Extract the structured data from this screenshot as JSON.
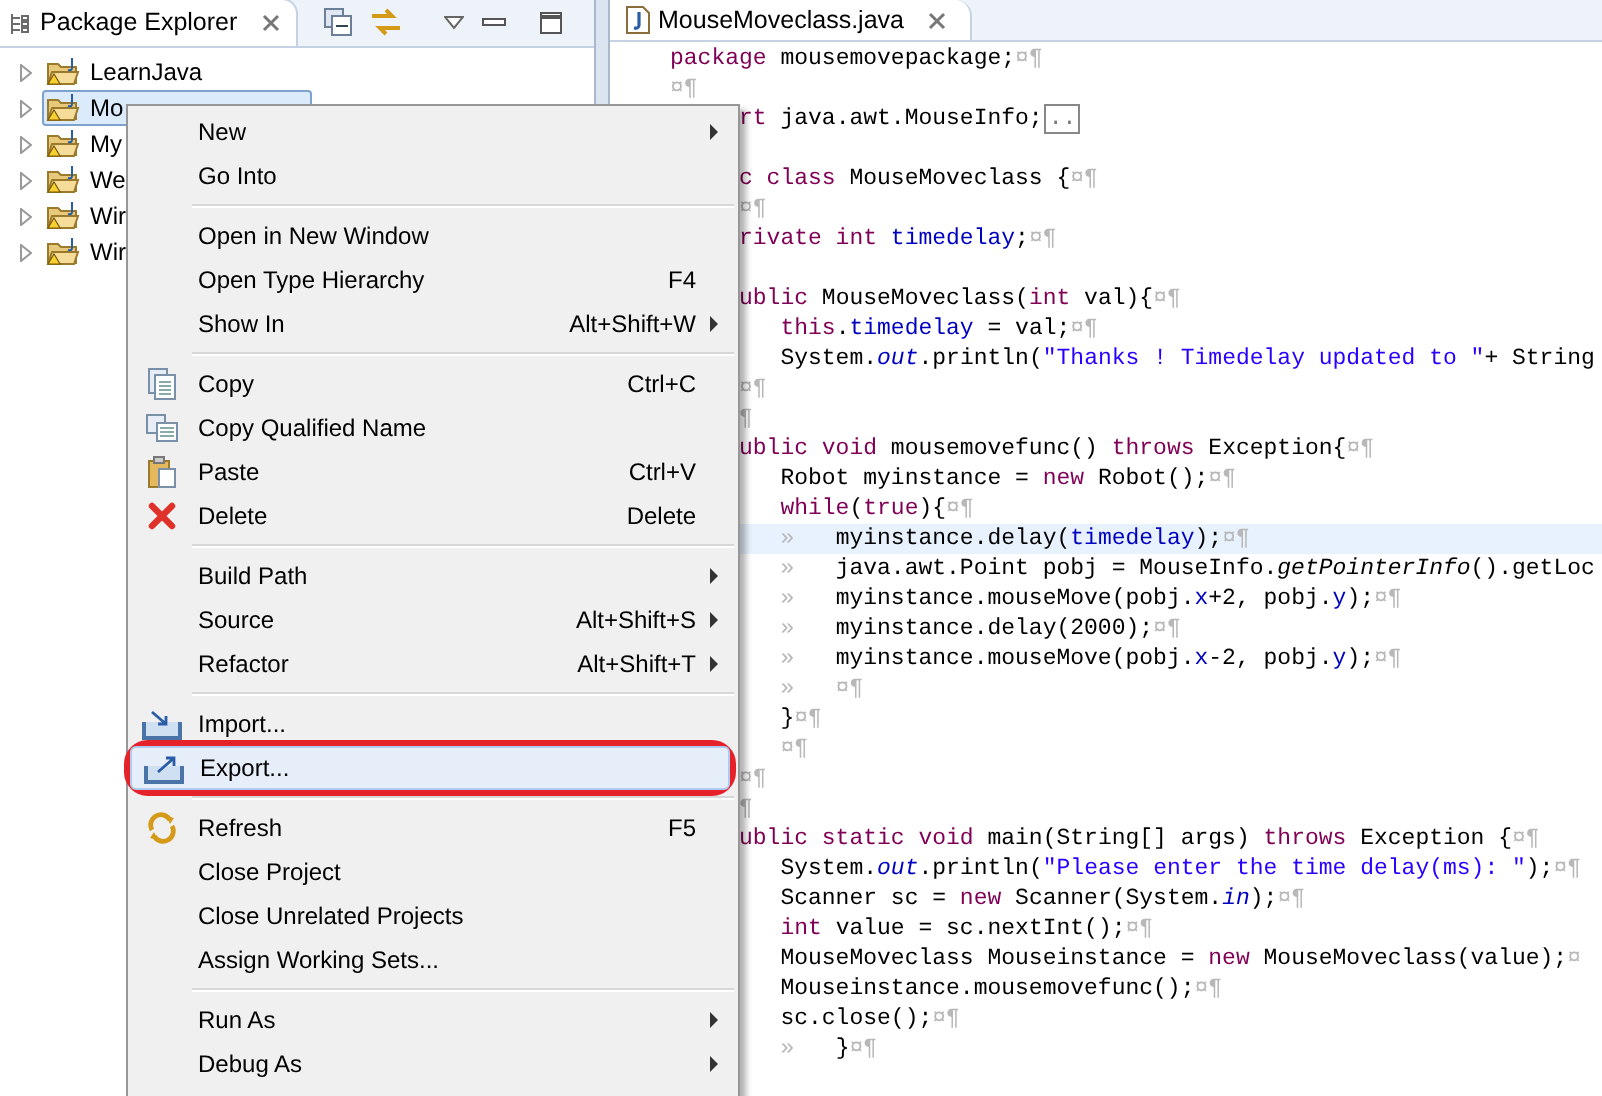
{
  "package_explorer": {
    "title": "Package Explorer",
    "tree": [
      {
        "label": "LearnJava",
        "selected": false,
        "expanded": false
      },
      {
        "label": "Mo",
        "selected": true,
        "expanded": false
      },
      {
        "label": "My",
        "selected": false,
        "expanded": false
      },
      {
        "label": "We",
        "selected": false,
        "expanded": false
      },
      {
        "label": "Wir",
        "selected": false,
        "expanded": false
      },
      {
        "label": "Wir",
        "selected": false,
        "expanded": false
      }
    ]
  },
  "editor": {
    "tab": "MouseMoveclass.java",
    "lines": [
      {
        "kind": "top",
        "current": false,
        "tokens": [
          {
            "kind": "kw",
            "text": "package"
          },
          {
            "kind": "p",
            "text": " mousemovepackage;"
          },
          {
            "kind": "ws",
            "text": "¤¶"
          }
        ]
      },
      {
        "kind": "top",
        "current": false,
        "tokens": [
          {
            "kind": "ws",
            "text": "¤¶"
          }
        ]
      },
      {
        "kind": "cut",
        "current": false,
        "tokens": [
          {
            "kind": "kw",
            "text": "rt"
          },
          {
            "kind": "p",
            "text": " java.awt.MouseInfo;"
          },
          {
            "kind": "fold",
            "text": ".."
          }
        ]
      },
      {
        "kind": "blank",
        "current": false
      },
      {
        "kind": "cut",
        "current": false,
        "tokens": [
          {
            "kind": "kw",
            "text": "c class"
          },
          {
            "kind": "p",
            "text": " MouseMoveclass {"
          },
          {
            "kind": "ws",
            "text": "¤¶"
          }
        ]
      },
      {
        "kind": "cut",
        "current": false,
        "tokens": [
          {
            "kind": "ws",
            "text": "¤¶"
          }
        ]
      },
      {
        "kind": "cut",
        "current": false,
        "tokens": [
          {
            "kind": "kw",
            "text": "rivate int"
          },
          {
            "kind": "fld",
            "text": " timedelay"
          },
          {
            "kind": "p",
            "text": ";"
          },
          {
            "kind": "ws",
            "text": "¤¶"
          }
        ]
      },
      {
        "kind": "blank",
        "current": false
      },
      {
        "kind": "cut",
        "current": false,
        "tokens": [
          {
            "kind": "kw",
            "text": "ublic"
          },
          {
            "kind": "p",
            "text": " MouseMoveclass("
          },
          {
            "kind": "kw",
            "text": "int"
          },
          {
            "kind": "p",
            "text": " val){"
          },
          {
            "kind": "ws",
            "text": "¤¶"
          }
        ]
      },
      {
        "kind": "body",
        "current": false,
        "tokens": [
          {
            "kind": "kw",
            "text": "this"
          },
          {
            "kind": "p",
            "text": "."
          },
          {
            "kind": "fld",
            "text": "timedelay"
          },
          {
            "kind": "p",
            "text": " = val;"
          },
          {
            "kind": "ws",
            "text": "¤¶"
          }
        ]
      },
      {
        "kind": "body",
        "current": false,
        "tokens": [
          {
            "kind": "p",
            "text": "System."
          },
          {
            "kind": "sfld",
            "text": "out"
          },
          {
            "kind": "p",
            "text": ".println("
          },
          {
            "kind": "str",
            "text": "\"Thanks ! Timedelay updated to \""
          },
          {
            "kind": "p",
            "text": "+ String"
          }
        ]
      },
      {
        "kind": "cut",
        "current": false,
        "tokens": [
          {
            "kind": "ws",
            "text": "¤¶"
          }
        ]
      },
      {
        "kind": "cut",
        "current": false,
        "tokens": [
          {
            "kind": "ws",
            "text": "¶"
          }
        ]
      },
      {
        "kind": "cut",
        "current": false,
        "tokens": [
          {
            "kind": "kw",
            "text": "ublic void"
          },
          {
            "kind": "p",
            "text": " mousemovefunc() "
          },
          {
            "kind": "kw",
            "text": "throws"
          },
          {
            "kind": "p",
            "text": " Exception{"
          },
          {
            "kind": "ws",
            "text": "¤¶"
          }
        ]
      },
      {
        "kind": "body",
        "current": false,
        "tokens": [
          {
            "kind": "p",
            "text": "Robot myinstance = "
          },
          {
            "kind": "kw",
            "text": "new"
          },
          {
            "kind": "p",
            "text": " Robot();"
          },
          {
            "kind": "ws",
            "text": "¤¶"
          }
        ]
      },
      {
        "kind": "body",
        "current": false,
        "tokens": [
          {
            "kind": "kw",
            "text": "while"
          },
          {
            "kind": "p",
            "text": "("
          },
          {
            "kind": "kw",
            "text": "true"
          },
          {
            "kind": "p",
            "text": "){"
          },
          {
            "kind": "ws",
            "text": "¤¶"
          }
        ]
      },
      {
        "kind": "body",
        "current": true,
        "tokens": [
          {
            "kind": "ws",
            "text": "»"
          },
          {
            "kind": "p",
            "text": "   myinstance.delay("
          },
          {
            "kind": "fld",
            "text": "timedelay"
          },
          {
            "kind": "p",
            "text": ");"
          },
          {
            "kind": "ws",
            "text": "¤¶"
          }
        ]
      },
      {
        "kind": "body",
        "current": false,
        "tokens": [
          {
            "kind": "ws",
            "text": "»"
          },
          {
            "kind": "p",
            "text": "   java.awt.Point pobj = MouseInfo."
          },
          {
            "kind": "it",
            "text": "getPointerInfo"
          },
          {
            "kind": "p",
            "text": "().getLoc"
          }
        ]
      },
      {
        "kind": "body",
        "current": false,
        "tokens": [
          {
            "kind": "ws",
            "text": "»"
          },
          {
            "kind": "p",
            "text": "   myinstance.mouseMove(pobj."
          },
          {
            "kind": "fld",
            "text": "x"
          },
          {
            "kind": "p",
            "text": "+2, pobj."
          },
          {
            "kind": "fld",
            "text": "y"
          },
          {
            "kind": "p",
            "text": ");"
          },
          {
            "kind": "ws",
            "text": "¤¶"
          }
        ]
      },
      {
        "kind": "body",
        "current": false,
        "tokens": [
          {
            "kind": "ws",
            "text": "»"
          },
          {
            "kind": "p",
            "text": "   myinstance.delay(2000);"
          },
          {
            "kind": "ws",
            "text": "¤¶"
          }
        ]
      },
      {
        "kind": "body",
        "current": false,
        "tokens": [
          {
            "kind": "ws",
            "text": "»"
          },
          {
            "kind": "p",
            "text": "   myinstance.mouseMove(pobj."
          },
          {
            "kind": "fld",
            "text": "x"
          },
          {
            "kind": "p",
            "text": "-2, pobj."
          },
          {
            "kind": "fld",
            "text": "y"
          },
          {
            "kind": "p",
            "text": ");"
          },
          {
            "kind": "ws",
            "text": "¤¶"
          }
        ]
      },
      {
        "kind": "body",
        "current": false,
        "tokens": [
          {
            "kind": "ws",
            "text": "»   ¤¶"
          }
        ]
      },
      {
        "kind": "body",
        "current": false,
        "tokens": [
          {
            "kind": "p",
            "text": "}"
          },
          {
            "kind": "ws",
            "text": "¤¶"
          }
        ]
      },
      {
        "kind": "body",
        "current": false,
        "tokens": [
          {
            "kind": "ws",
            "text": "¤¶"
          }
        ]
      },
      {
        "kind": "cut",
        "current": false,
        "tokens": [
          {
            "kind": "ws",
            "text": "¤¶"
          }
        ]
      },
      {
        "kind": "cut",
        "current": false,
        "tokens": [
          {
            "kind": "ws",
            "text": "¶"
          }
        ]
      },
      {
        "kind": "cut",
        "current": false,
        "tokens": [
          {
            "kind": "kw",
            "text": "ublic static void"
          },
          {
            "kind": "p",
            "text": " main(String[] args) "
          },
          {
            "kind": "kw",
            "text": "throws"
          },
          {
            "kind": "p",
            "text": " Exception {"
          },
          {
            "kind": "ws",
            "text": "¤¶"
          }
        ]
      },
      {
        "kind": "body",
        "current": false,
        "tokens": [
          {
            "kind": "p",
            "text": "System."
          },
          {
            "kind": "sfld",
            "text": "out"
          },
          {
            "kind": "p",
            "text": ".println("
          },
          {
            "kind": "str",
            "text": "\"Please enter the time delay(ms): \""
          },
          {
            "kind": "p",
            "text": ");"
          },
          {
            "kind": "ws",
            "text": "¤¶"
          }
        ]
      },
      {
        "kind": "body",
        "current": false,
        "tokens": [
          {
            "kind": "p",
            "text": "Scanner sc = "
          },
          {
            "kind": "kw",
            "text": "new"
          },
          {
            "kind": "p",
            "text": " Scanner(System."
          },
          {
            "kind": "sfld",
            "text": "in"
          },
          {
            "kind": "p",
            "text": ");"
          },
          {
            "kind": "ws",
            "text": "¤¶"
          }
        ]
      },
      {
        "kind": "body",
        "current": false,
        "tokens": [
          {
            "kind": "kw",
            "text": "int"
          },
          {
            "kind": "p",
            "text": " value = sc.nextInt();"
          },
          {
            "kind": "ws",
            "text": "¤¶"
          }
        ]
      },
      {
        "kind": "body",
        "current": false,
        "tokens": [
          {
            "kind": "p",
            "text": "MouseMoveclass Mouseinstance = "
          },
          {
            "kind": "kw",
            "text": "new"
          },
          {
            "kind": "p",
            "text": " MouseMoveclass(value);"
          },
          {
            "kind": "ws",
            "text": "¤"
          }
        ]
      },
      {
        "kind": "body",
        "current": false,
        "tokens": [
          {
            "kind": "p",
            "text": "Mouseinstance.mousemovefunc();"
          },
          {
            "kind": "ws",
            "text": "¤¶"
          }
        ]
      },
      {
        "kind": "body",
        "current": false,
        "tokens": [
          {
            "kind": "p",
            "text": "sc.close();"
          },
          {
            "kind": "ws",
            "text": "¤¶"
          }
        ]
      },
      {
        "kind": "body",
        "current": false,
        "tokens": [
          {
            "kind": "ws",
            "text": "»"
          },
          {
            "kind": "p",
            "text": "   }"
          },
          {
            "kind": "ws",
            "text": "¤¶"
          }
        ]
      }
    ]
  },
  "context_menu": {
    "items": [
      {
        "kind": "item",
        "label": "New",
        "submenu": true,
        "selected": false,
        "circled": false
      },
      {
        "kind": "item",
        "label": "Go Into",
        "submenu": false,
        "selected": false,
        "circled": false
      },
      {
        "kind": "separator"
      },
      {
        "kind": "item",
        "label": "Open in New Window",
        "submenu": false,
        "selected": false,
        "circled": false
      },
      {
        "kind": "item",
        "label": "Open Type Hierarchy",
        "shortcut": "F4",
        "submenu": false,
        "selected": false,
        "circled": false
      },
      {
        "kind": "item",
        "label": "Show In",
        "shortcut": "Alt+Shift+W",
        "submenu": true,
        "selected": false,
        "circled": false
      },
      {
        "kind": "separator"
      },
      {
        "kind": "item",
        "label": "Copy",
        "shortcut": "Ctrl+C",
        "submenu": false,
        "selected": false,
        "circled": false
      },
      {
        "kind": "item",
        "label": "Copy Qualified Name",
        "submenu": false,
        "selected": false,
        "circled": false
      },
      {
        "kind": "item",
        "label": "Paste",
        "shortcut": "Ctrl+V",
        "submenu": false,
        "selected": false,
        "circled": false
      },
      {
        "kind": "item",
        "label": "Delete",
        "shortcut": "Delete",
        "submenu": false,
        "selected": false,
        "circled": false
      },
      {
        "kind": "separator"
      },
      {
        "kind": "item",
        "label": "Build Path",
        "submenu": true,
        "selected": false,
        "circled": false
      },
      {
        "kind": "item",
        "label": "Source",
        "shortcut": "Alt+Shift+S",
        "submenu": true,
        "selected": false,
        "circled": false
      },
      {
        "kind": "item",
        "label": "Refactor",
        "shortcut": "Alt+Shift+T",
        "submenu": true,
        "selected": false,
        "circled": false
      },
      {
        "kind": "separator"
      },
      {
        "kind": "item",
        "label": "Import...",
        "submenu": false,
        "selected": false,
        "circled": false
      },
      {
        "kind": "item",
        "label": "Export...",
        "submenu": false,
        "selected": true,
        "circled": true
      },
      {
        "kind": "separator"
      },
      {
        "kind": "item",
        "label": "Refresh",
        "shortcut": "F5",
        "submenu": false,
        "selected": false,
        "circled": false
      },
      {
        "kind": "item",
        "label": "Close Project",
        "submenu": false,
        "selected": false,
        "circled": false
      },
      {
        "kind": "item",
        "label": "Close Unrelated Projects",
        "submenu": false,
        "selected": false,
        "circled": false
      },
      {
        "kind": "item",
        "label": "Assign Working Sets...",
        "submenu": false,
        "selected": false,
        "circled": false
      },
      {
        "kind": "separator"
      },
      {
        "kind": "item",
        "label": "Run As",
        "submenu": true,
        "selected": false,
        "circled": false
      },
      {
        "kind": "item",
        "label": "Debug As",
        "submenu": true,
        "selected": false,
        "circled": false
      }
    ]
  }
}
